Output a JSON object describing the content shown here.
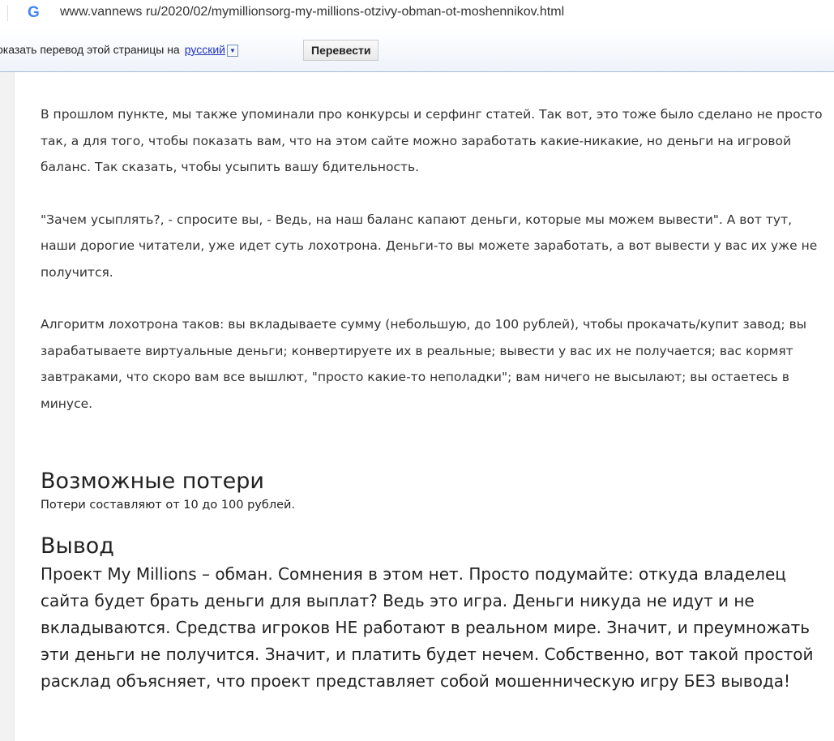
{
  "browser": {
    "url": "www.vannews ru/2020/02/mymillionsorg-my-millions-otzivy-obman-ot-moshennikov.html",
    "icon": "google-g-icon"
  },
  "translate_bar": {
    "message": "оказать перевод этой страницы на",
    "language": "русский",
    "button": "Перевести"
  },
  "article": {
    "paragraphs": [
      "В прошлом пункте, мы также упоминали про конкурсы и серфинг статей. Так вот, это тоже было сделано не просто так, а для того, чтобы показать вам, что на этом сайте можно заработать какие-никакие, но деньги на игровой баланс. Так сказать, чтобы усыпить вашу бдительность.",
      "\"Зачем усыплять?, - спросите вы, - Ведь, на наш баланс капают деньги, которые мы можем вывести\". А вот тут, наши дорогие читатели, уже идет суть лохотрона. Деньги-то вы можете заработать, а вот вывести у вас их уже не получится.",
      "Алгоритм лохотрона таков: вы вкладываете сумму (небольшую, до 100 рублей), чтобы прокачать/купит завод; вы зарабатываете виртуальные деньги; конвертируете их в реальные; вывести у вас их не получается; вас кормят завтраками, что скоро вам все вышлют, \"просто какие-то неполадки\"; вам ничего не высылают; вы остаетесь в минусе."
    ],
    "losses_heading": "Возможные потери",
    "losses_text": "Потери составляют от 10 до 100 рублей.",
    "conclusion_heading": "Вывод",
    "conclusion_text": "Проект My Millions – обман. Сомнения в этом нет. Просто подумайте: откуда владелец сайта будет брать деньги для выплат? Ведь это игра. Деньги никуда не идут и не вкладываются. Средства игроков НЕ работают в реальном мире. Значит, и преумножать эти деньги не получится. Значит, и платить будет нечем. Собственно, вот такой простой расклад объясняет, что проект представляет собой мошенническую игру БЕЗ вывода!"
  }
}
